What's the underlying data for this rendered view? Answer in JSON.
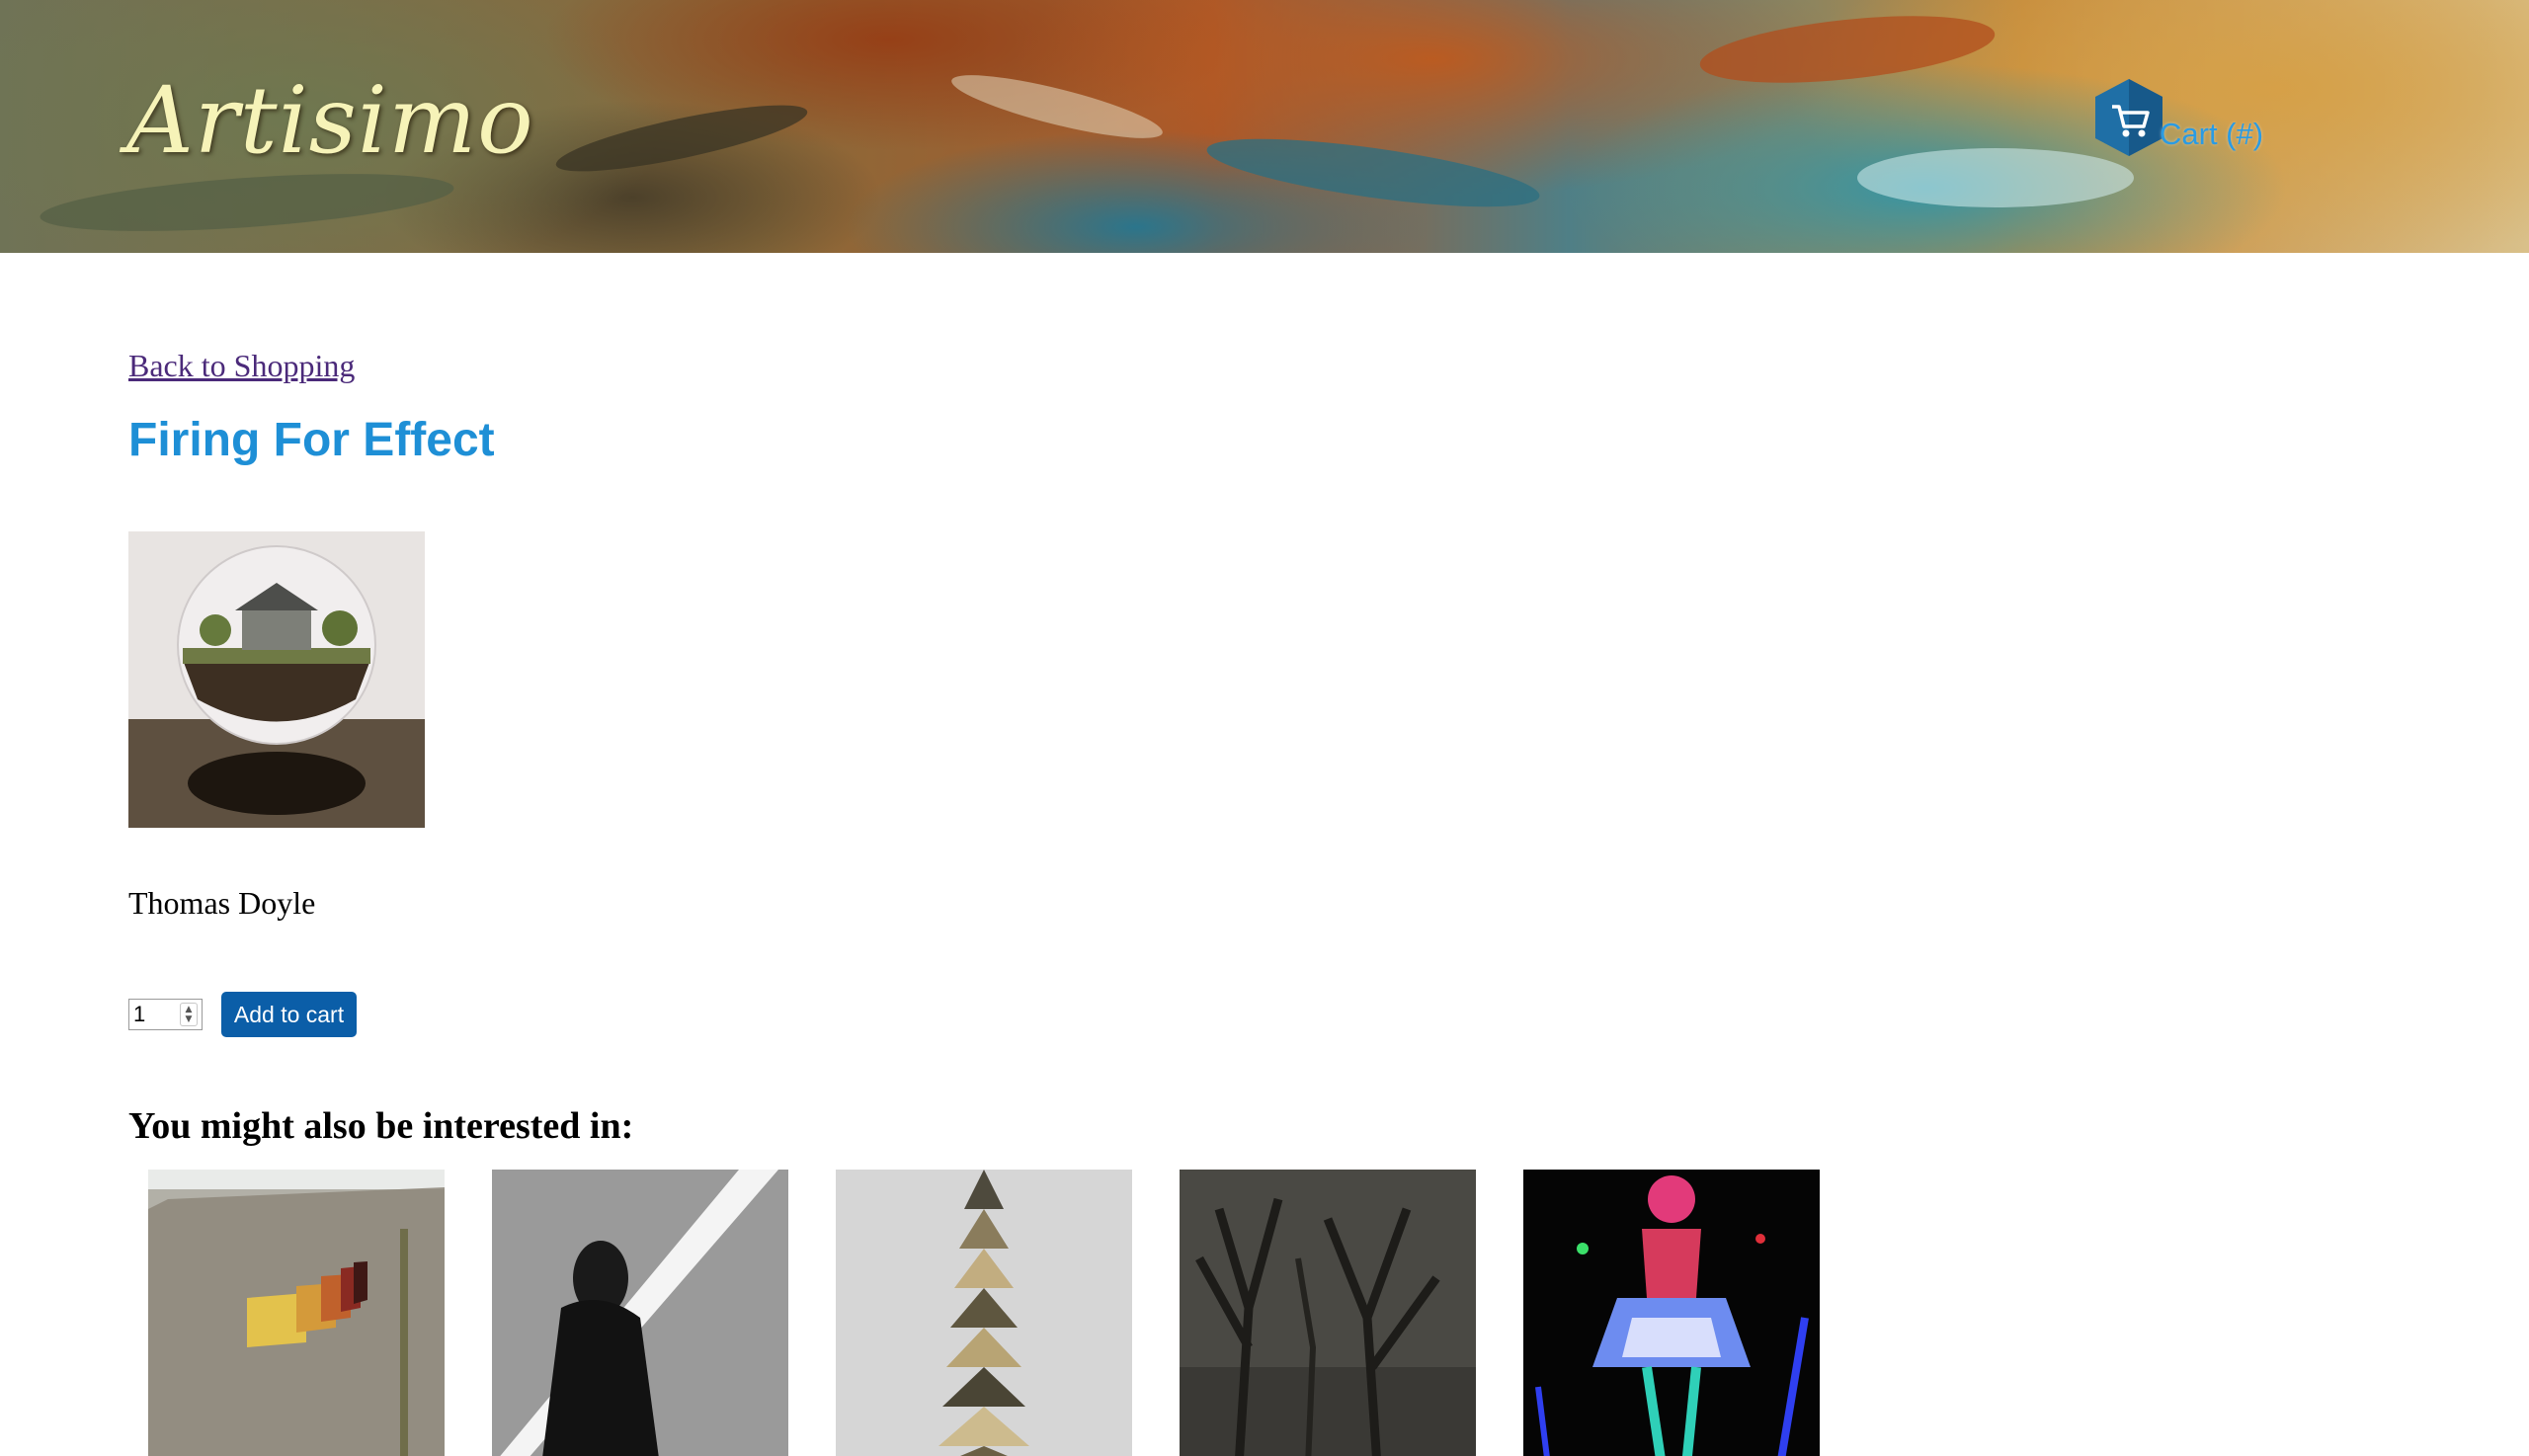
{
  "header": {
    "logo_text": "Artisimo",
    "cart_label": "Cart (#)",
    "cart_icon": "shopping-cart-hexagon-icon",
    "accent_color": "#2a9be3"
  },
  "main": {
    "back_link": "Back to Shopping",
    "product_title": "Firing For Effect",
    "artist": "Thomas Doyle",
    "quantity": "1",
    "add_to_cart_label": "Add to cart",
    "related_heading": "You might also be interested in:"
  },
  "colors": {
    "title": "#1e8fd6",
    "button": "#0b5ea8",
    "link": "#4b2a7a"
  }
}
